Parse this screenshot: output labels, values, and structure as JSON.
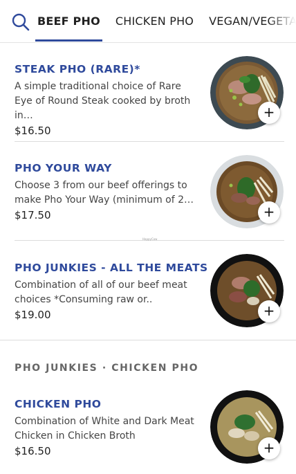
{
  "tabs": [
    {
      "label": "BEEF PHO"
    },
    {
      "label": "CHICKEN PHO"
    },
    {
      "label": "VEGAN/VEGETARIAN"
    }
  ],
  "items": [
    {
      "name": "STEAK PHO (RARE)*",
      "desc": "A simple traditional choice of Rare Eye of Round Steak cooked by broth in…",
      "price": "$16.50"
    },
    {
      "name": "PHO YOUR WAY",
      "desc": "Choose 3 from our beef offerings to make Pho Your Way (minimum of 2…",
      "price": "$17.50"
    },
    {
      "name": "PHO JUNKIES - ALL THE MEATS",
      "desc": "Combination of all of our beef meat choices    *Consuming raw or..",
      "price": "$19.00"
    },
    {
      "name": "CHICKEN PHO",
      "desc": "Combination of White and Dark Meat Chicken in Chicken Broth",
      "price": "$16.50"
    }
  ],
  "section_heading": "PHO JUNKIES · CHICKEN PHO",
  "add_label": "+",
  "watermark": "HappyCow",
  "colors": {
    "accent": "#2f4a9c"
  }
}
